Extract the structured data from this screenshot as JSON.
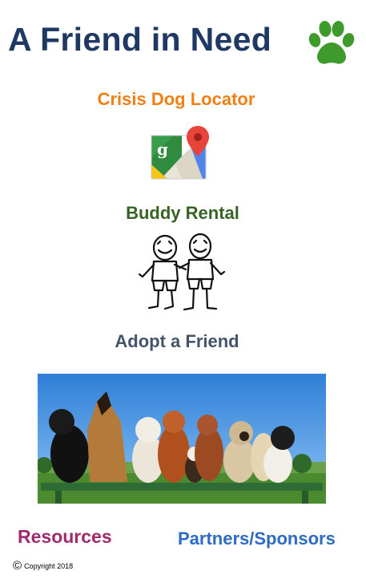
{
  "header": {
    "title": "A Friend in Need",
    "logo_icon": "paw-print-icon",
    "logo_color": "#3f9a2c"
  },
  "menu": {
    "crisis": {
      "label": "Crisis Dog Locator",
      "icon": "google-maps-icon"
    },
    "buddy": {
      "label": "Buddy Rental",
      "image": "two-kids-drawing"
    },
    "adopt": {
      "label": "Adopt a Friend",
      "image": "dogs-group-photo"
    }
  },
  "footer": {
    "resources": "Resources",
    "partners": "Partners/Sponsors",
    "copyright_symbol": "©",
    "copyright_text": "Copyright 2018"
  }
}
